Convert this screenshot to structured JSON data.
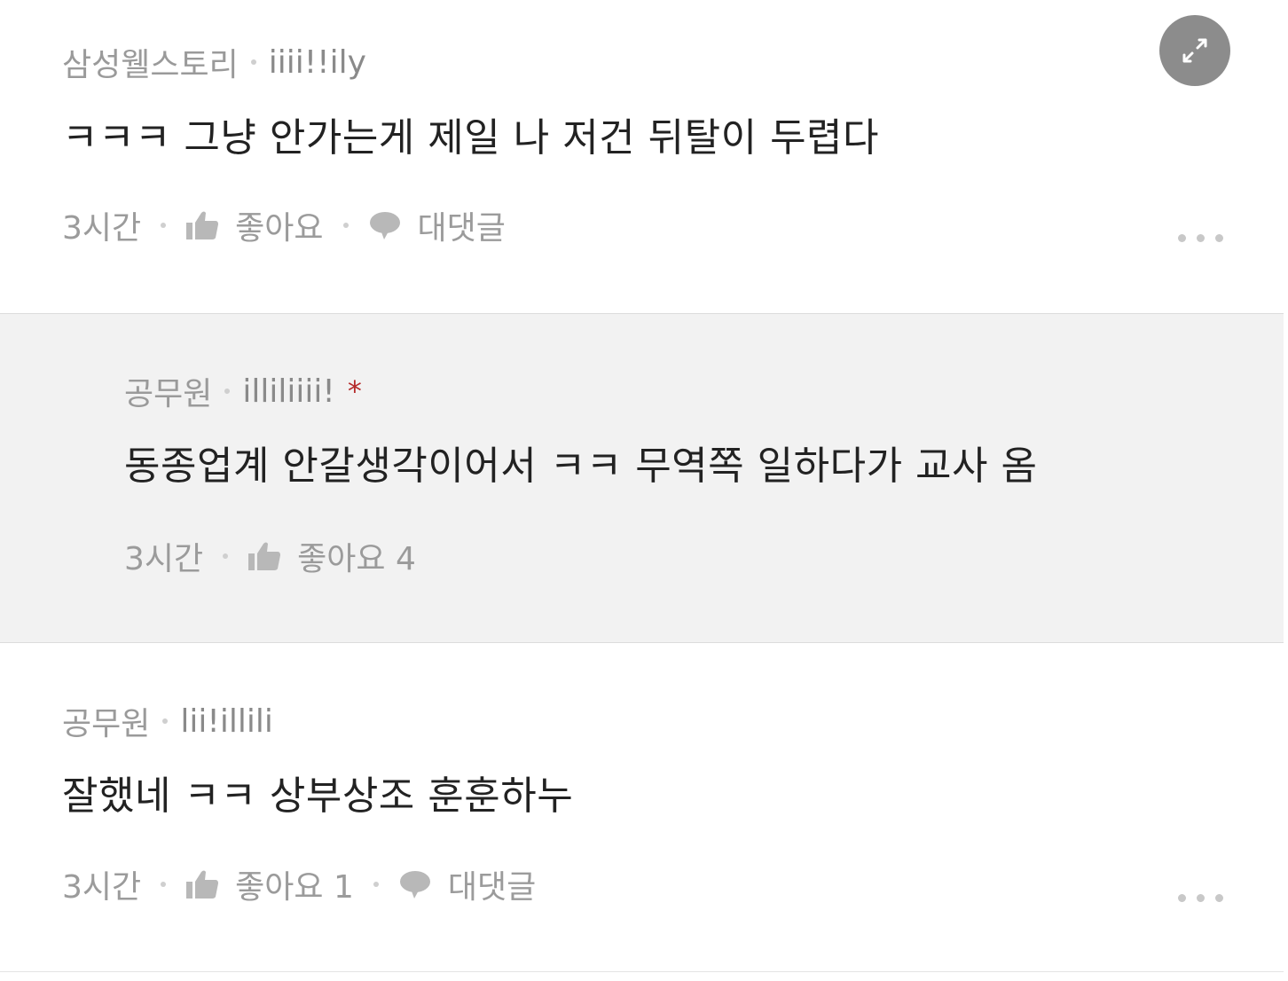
{
  "comments": [
    {
      "author": "삼성웰스토리",
      "handle": "iiii!!ily",
      "body": "ㅋㅋㅋ 그냥 안가는게 제일 나 저건 뒤탈이 두렵다",
      "time": "3시간",
      "like_label": "좋아요",
      "reply_label": "대댓글"
    },
    {
      "author": "공무원",
      "handle": "illiliiii!",
      "marker": "*",
      "body": "동종업계 안갈생각이어서 ㅋㅋ 무역쪽 일하다가 교사 옴",
      "time": "3시간",
      "like_label": "좋아요 4"
    },
    {
      "author": "공무원",
      "handle": "lii!illili",
      "body": "잘했네 ㅋㅋ 상부상조 훈훈하누",
      "time": "3시간",
      "like_label": "좋아요 1",
      "reply_label": "대댓글"
    }
  ],
  "icons": {
    "like": "thumbs-up-icon",
    "reply": "speech-bubble-icon",
    "more": "more-dots-icon",
    "expand": "expand-arrows-icon"
  },
  "colors": {
    "meta_text": "#9b9b9b",
    "body_text": "#222222",
    "reply_bg": "#f2f2f2",
    "marker": "#b52a2a",
    "expand_bg": "#8c8c8c"
  }
}
